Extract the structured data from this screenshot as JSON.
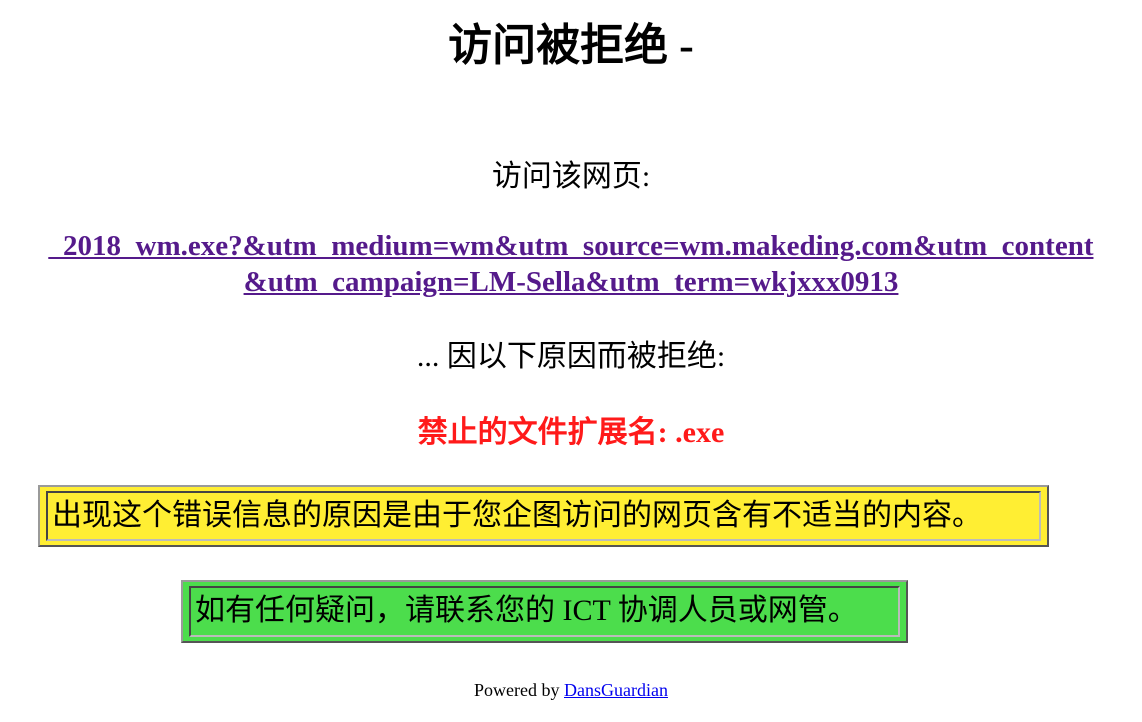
{
  "heading": "访问被拒绝 -",
  "access_label": "访问该网页:",
  "blocked_url": {
    "line1": "_2018_wm.exe?&utm_medium=wm&utm_source=wm.makeding.com&utm_content",
    "line2": "&utm_campaign=LM-Sella&utm_term=wkjxxx0913"
  },
  "reason_label": "... 因以下原因而被拒绝:",
  "reason": "禁止的文件扩展名: .exe",
  "explanation": "出现这个错误信息的原因是由于您企图访问的网页含有不适当的内容。",
  "contact": "如有任何疑问，请联系您的 ICT 协调人员或网管。",
  "footer": {
    "powered_by": "Powered by",
    "link_text": "DansGuardian"
  },
  "colors": {
    "reason_text": "#ff1a1a",
    "link": "#551a8b",
    "footer_link": "#0000ee",
    "explanation_bg": "#ffee33",
    "contact_bg": "#4cdd4c"
  }
}
